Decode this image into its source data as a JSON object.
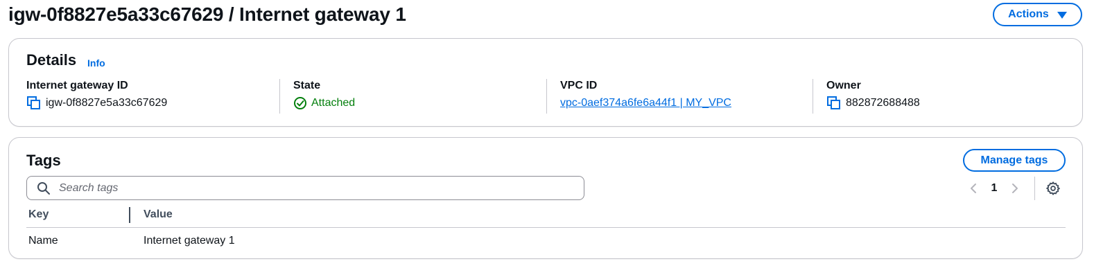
{
  "header": {
    "title": "igw-0f8827e5a33c67629 / Internet gateway 1",
    "actions_label": "Actions"
  },
  "details": {
    "heading": "Details",
    "info_label": "Info",
    "fields": [
      {
        "label": "Internet gateway ID",
        "value": "igw-0f8827e5a33c67629"
      },
      {
        "label": "State",
        "value": "Attached"
      },
      {
        "label": "VPC ID",
        "value": "vpc-0aef374a6fe6a44f1 | MY_VPC"
      },
      {
        "label": "Owner",
        "value": "882872688488"
      }
    ]
  },
  "tags": {
    "heading": "Tags",
    "manage_label": "Manage tags",
    "search_placeholder": "Search tags",
    "search_value": "",
    "page": "1",
    "columns": [
      "Key",
      "Value"
    ],
    "rows": [
      {
        "key": "Name",
        "value": "Internet gateway 1"
      }
    ]
  },
  "colors": {
    "accent": "#006ce0",
    "success": "#037f0c",
    "text": "#0f141a",
    "border": "#c6c6cd"
  },
  "icons": {
    "copy": "copy-icon",
    "status": "check-circle-icon",
    "search": "search-icon",
    "prev": "chevron-left-icon",
    "next": "chevron-right-icon",
    "settings": "gear-icon",
    "dropdown": "caret-down-icon"
  }
}
